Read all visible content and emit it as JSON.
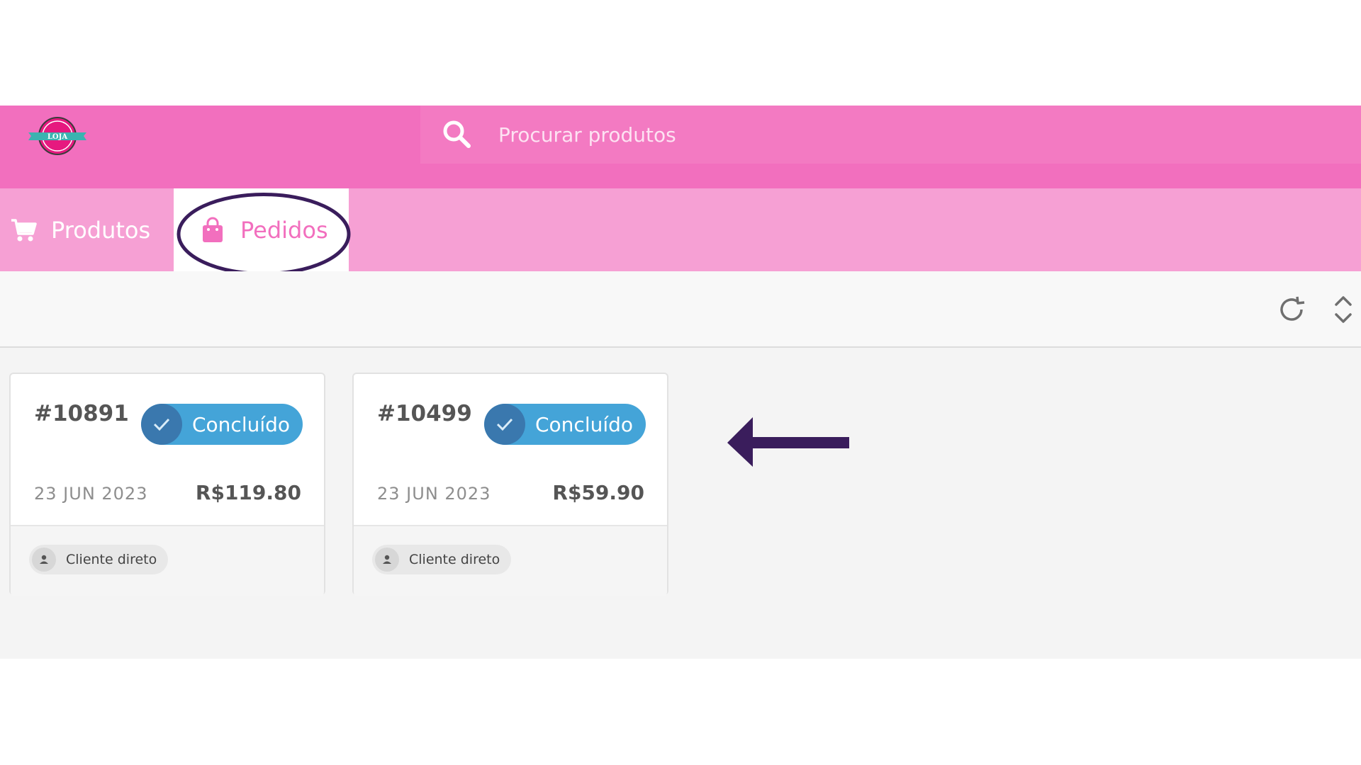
{
  "header": {
    "logo_text": "LOJA",
    "search": {
      "placeholder": "Procurar produtos",
      "value": ""
    }
  },
  "tabs": [
    {
      "label": "Produtos",
      "icon": "cart-icon",
      "active": false
    },
    {
      "label": "Pedidos",
      "icon": "shopping-bag-icon",
      "active": true
    }
  ],
  "toolbar": {
    "icons": [
      "refresh-icon",
      "sort-icon"
    ]
  },
  "orders": [
    {
      "id": "#10891",
      "status": "Concluído",
      "date": "23 JUN 2023",
      "total": "R$119.80",
      "customer": "Cliente direto"
    },
    {
      "id": "#10499",
      "status": "Concluído",
      "date": "23 JUN 2023",
      "total": "R$59.90",
      "customer": "Cliente direto"
    }
  ],
  "colors": {
    "header": "#f26fbe",
    "tab_bar": "#f6a0d4",
    "status_badge": "#44a4d8",
    "annotation": "#3a1d5c"
  }
}
